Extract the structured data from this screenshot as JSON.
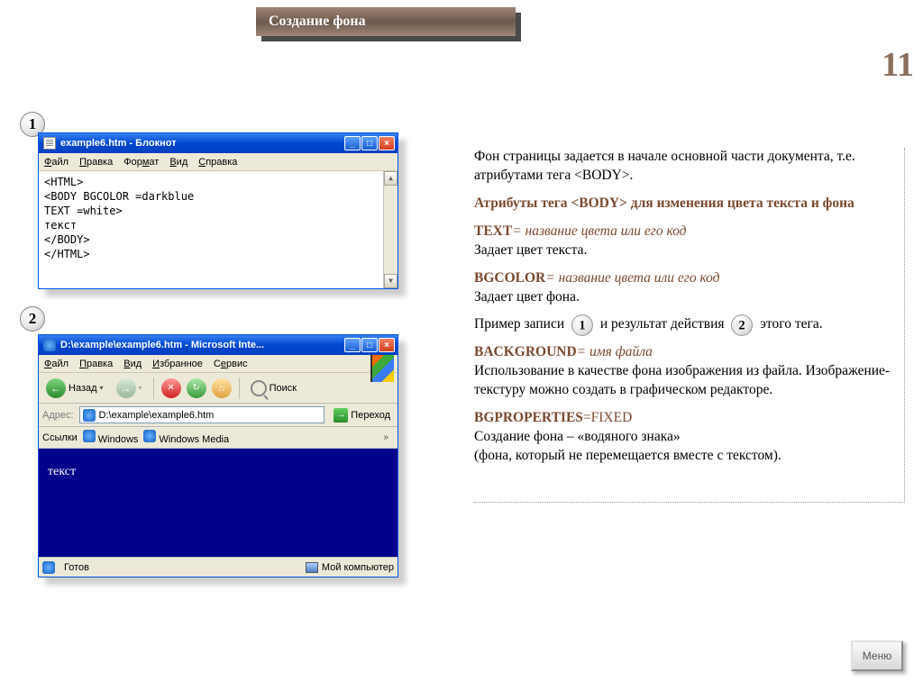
{
  "slide": {
    "title": "Создание фона",
    "number": "11",
    "ref1": "1",
    "ref2": "2",
    "menu_button": "Меню"
  },
  "notepad": {
    "title": "example6.htm - Блокнот",
    "menu": {
      "file": "Файл",
      "edit": "Правка",
      "format": "Формат",
      "view": "Вид",
      "help": "Справка"
    },
    "lines": [
      "<HTML>",
      "<BODY BGCOLOR =darkblue",
      "TEXT =white>",
      "текст",
      "</BODY>",
      "</HTML>"
    ]
  },
  "ie": {
    "title": "D:\\example\\example6.htm - Microsoft Inte...",
    "menu": {
      "file": "Файл",
      "edit": "Правка",
      "view": "Вид",
      "fav": "Избранное",
      "tools": "Сервис"
    },
    "nav": {
      "back": "Назад",
      "search": "Поиск"
    },
    "addr": {
      "label": "Адрес:",
      "value": "D:\\example\\example6.htm",
      "go": "Переход"
    },
    "links": {
      "label": "Ссылки",
      "win": "Windows",
      "wm": "Windows Media"
    },
    "page_text": "текст",
    "status": {
      "ready": "Готов",
      "zone": "Мой компьютер"
    }
  },
  "text": {
    "p1a": "Фон страницы задается в начале основной части документа, т.е. атрибутами тега ",
    "p1b": "<BODY>.",
    "h2a": "Атрибуты тега ",
    "h2b": "<BODY>",
    "h2c": " для изменения цвета текста и фона",
    "t_lbl": "TEXT",
    "t_val": "= название цвета     или его код",
    "t_desc": "Задает цвет текста.",
    "bg_lbl": "BGCOLOR",
    "bg_val": "= название цвета или его код",
    "bg_desc": "Задает цвет фона.",
    "ex_a": "Пример записи",
    "ex_b": "и результат действия",
    "ex_c": "этого тега.",
    "bk_lbl": "BACKGROUND",
    "bk_val": "= имя файла",
    "bk_desc": "Использование в качестве фона изображения из файла. Изображение-текстуру можно создать в графическом редакторе.",
    "bp_lbl": "BGPROPERTIES",
    "bp_val": "=FIXED",
    "bp_desc1": "Создание фона – «водяного знака»",
    "bp_desc2": "(фона, который не перемещается вместе с текстом)."
  }
}
